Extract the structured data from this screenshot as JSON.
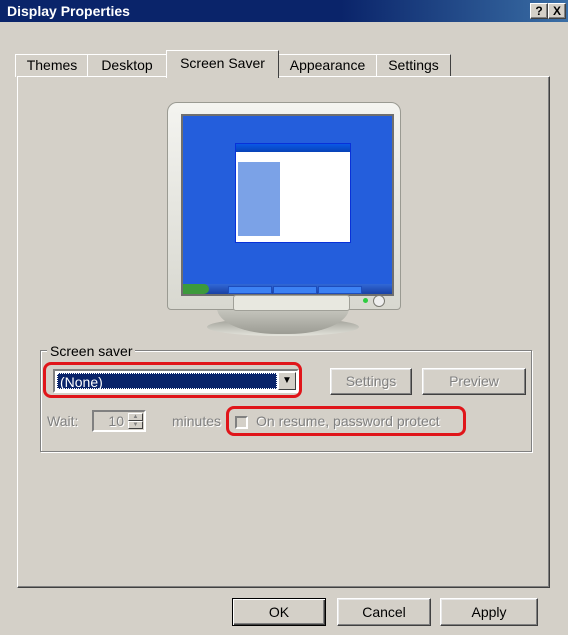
{
  "window": {
    "title": "Display Properties",
    "help_label": "?",
    "close_label": "X"
  },
  "tabs": [
    {
      "label": "Themes"
    },
    {
      "label": "Desktop"
    },
    {
      "label": "Screen Saver"
    },
    {
      "label": "Appearance"
    },
    {
      "label": "Settings"
    }
  ],
  "screen_saver": {
    "group_label": "Screen saver",
    "selected": "(None)",
    "settings_label": "Settings",
    "preview_label": "Preview",
    "wait_label": "Wait:",
    "wait_value": "10",
    "minutes_label": "minutes",
    "password_label": "On resume, password protect"
  },
  "footer": {
    "ok_label": "OK",
    "cancel_label": "Cancel",
    "apply_label": "Apply"
  },
  "colors": {
    "title_bar": "#0a246a",
    "face": "#d4d0c8",
    "annotation": "#e0151a"
  }
}
